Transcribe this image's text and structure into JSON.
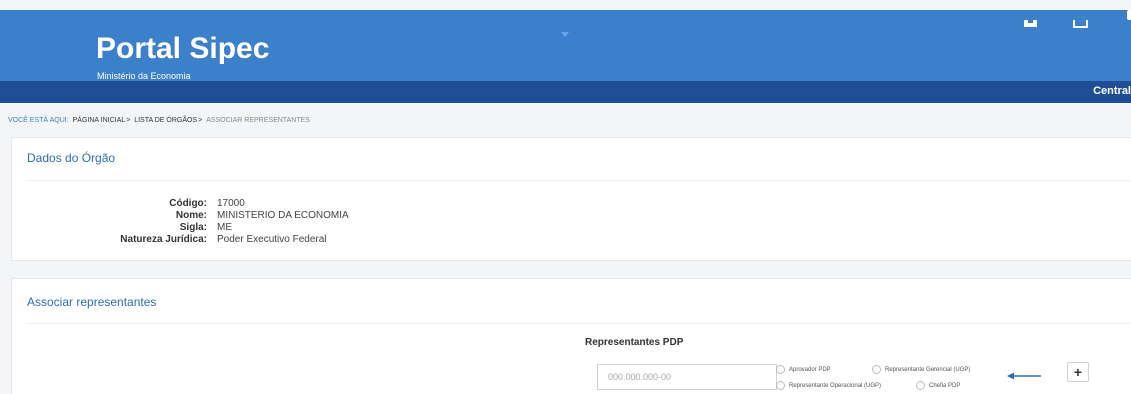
{
  "header": {
    "title": "Portal Sipec",
    "subtitle": "Ministério da Economia",
    "nav_right_label": "Central"
  },
  "breadcrumb": {
    "prefix": "VOCÊ ESTÁ AQUI:",
    "items": [
      "PÁGINA INICIAL",
      "LISTA DE ÓRGÃOS",
      "ASSOCIAR REPRESENTANTES"
    ],
    "separator": ">"
  },
  "orgao": {
    "title": "Dados do Órgão",
    "fields": [
      {
        "label": "Código:",
        "value": "17000"
      },
      {
        "label": "Nome:",
        "value": "MINISTERIO DA ECONOMIA"
      },
      {
        "label": "Sigla:",
        "value": "ME"
      },
      {
        "label": "Natureza Jurídica:",
        "value": "Poder Executivo Federal"
      }
    ]
  },
  "associar": {
    "title": "Associar representantes",
    "representantes_title": "Representantes PDP",
    "cpf_placeholder": "000.000.000-00",
    "roles": [
      "Aprovador PDP",
      "Representante Gerencial (UGP)",
      "Representante Operacional (UGP)",
      "Chefia PDP"
    ],
    "add_label": "+"
  },
  "colors": {
    "header_bg": "#3c7fcb",
    "nav_bg": "#1f4e96",
    "accent": "#2a6fb8"
  }
}
